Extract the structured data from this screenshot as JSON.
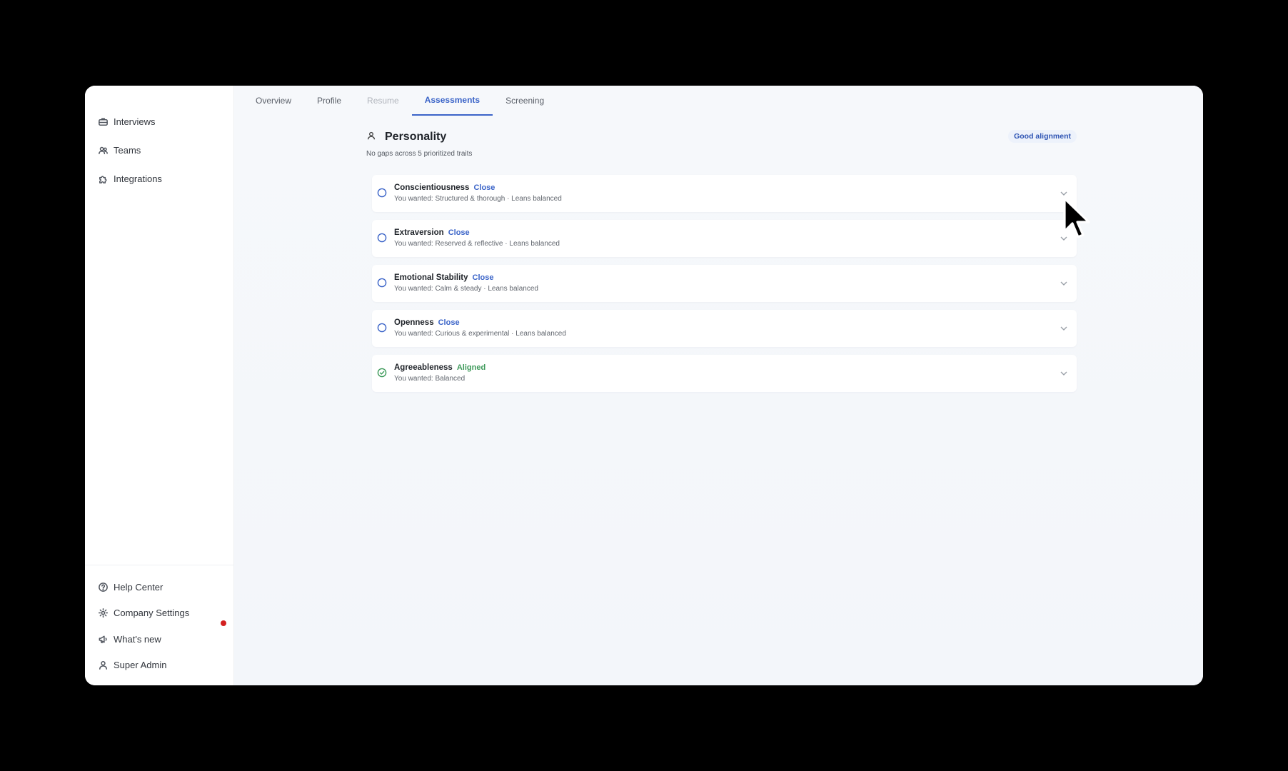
{
  "sidebar": {
    "top_items": [
      {
        "label": "Interviews",
        "icon": "briefcase-icon"
      },
      {
        "label": "Teams",
        "icon": "users-icon"
      },
      {
        "label": "Integrations",
        "icon": "puzzle-icon"
      }
    ],
    "bottom_items": [
      {
        "label": "Help Center",
        "icon": "help-circle-icon"
      },
      {
        "label": "Company Settings",
        "icon": "gear-icon"
      },
      {
        "label": "What's new",
        "icon": "megaphone-icon"
      },
      {
        "label": "Super Admin",
        "icon": "user-icon"
      }
    ]
  },
  "tabs": [
    {
      "label": "Overview",
      "state": "normal"
    },
    {
      "label": "Profile",
      "state": "normal"
    },
    {
      "label": "Resume",
      "state": "dim"
    },
    {
      "label": "Assessments",
      "state": "active"
    },
    {
      "label": "Screening",
      "state": "normal"
    }
  ],
  "section": {
    "title": "Personality",
    "subtitle": "No gaps across 5 prioritized traits",
    "badge": "Good alignment"
  },
  "traits": [
    {
      "name": "Conscientiousness",
      "tag": "Close",
      "desc": "You wanted: Structured & thorough · Leans balanced"
    },
    {
      "name": "Extraversion",
      "tag": "Close",
      "desc": "You wanted: Reserved & reflective · Leans balanced"
    },
    {
      "name": "Emotional Stability",
      "tag": "Close",
      "desc": "You wanted: Calm & steady · Leans balanced"
    },
    {
      "name": "Openness",
      "tag": "Close",
      "desc": "You wanted: Curious & experimental · Leans balanced"
    },
    {
      "name": "Agreeableness",
      "tag": "Aligned",
      "desc": "You wanted: Balanced"
    }
  ],
  "colors": {
    "accent": "#3b64c8",
    "aligned": "#3d9a5a",
    "notification": "#d32020"
  }
}
